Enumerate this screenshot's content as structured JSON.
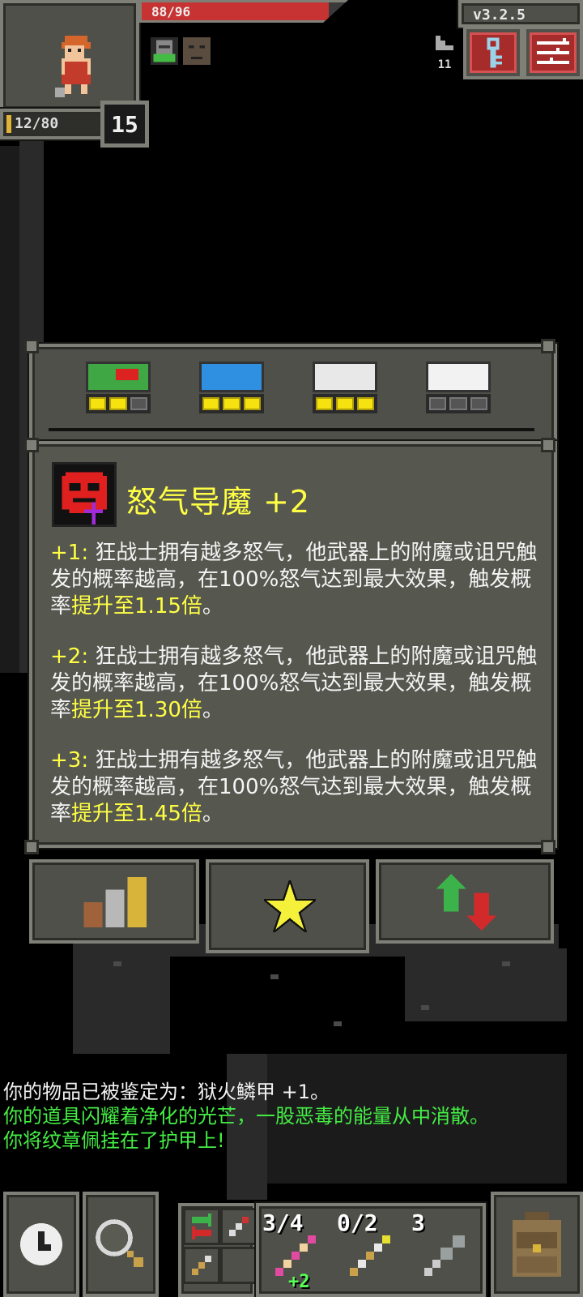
{
  "hero": {
    "hp_text": "88/96",
    "hp_fraction": 0.917,
    "exp_text": "12/80",
    "exp_fraction": 0.15,
    "level": "15"
  },
  "header": {
    "version": "v3.2.5",
    "depth": "11"
  },
  "talent": {
    "name": "怒气导魔 +2",
    "tiers": [
      {
        "level": "+1:",
        "text": "狂战士拥有越多怒气，他武器上的附魔或诅咒触发的概率越高，在100%怒气达到最大效果，触发概率",
        "highlight": "提升至1.15倍",
        "end": "。"
      },
      {
        "level": "+2:",
        "text": "狂战士拥有越多怒气，他武器上的附魔或诅咒触发的概率越高，在100%怒气达到最大效果，触发概率",
        "highlight": "提升至1.30倍",
        "end": "。"
      },
      {
        "level": "+3:",
        "text": "狂战士拥有越多怒气，他武器上的附魔或诅咒触发的概率越高，在100%怒气达到最大效果，触发概率",
        "highlight": "提升至1.45倍",
        "end": "。"
      }
    ]
  },
  "log": [
    "你的物品已被鉴定为：狱火鳞甲 +1。",
    "你的道具闪耀着净化的光芒，一股恶毒的能量从中消散。",
    "你将纹章佩挂在了护甲上!"
  ],
  "quickslots": [
    {
      "count": "3/4",
      "bonus": "+2",
      "icon": "wand-icon"
    },
    {
      "count": "0/2",
      "bonus": "",
      "icon": "wand-icon"
    },
    {
      "count": "3",
      "bonus": "",
      "icon": "throwing-spear-icon"
    }
  ],
  "colors": {
    "highlight": "#ffff44",
    "log_green": "#44ee44",
    "hp": "#c73333",
    "panel": "#4f5049"
  }
}
